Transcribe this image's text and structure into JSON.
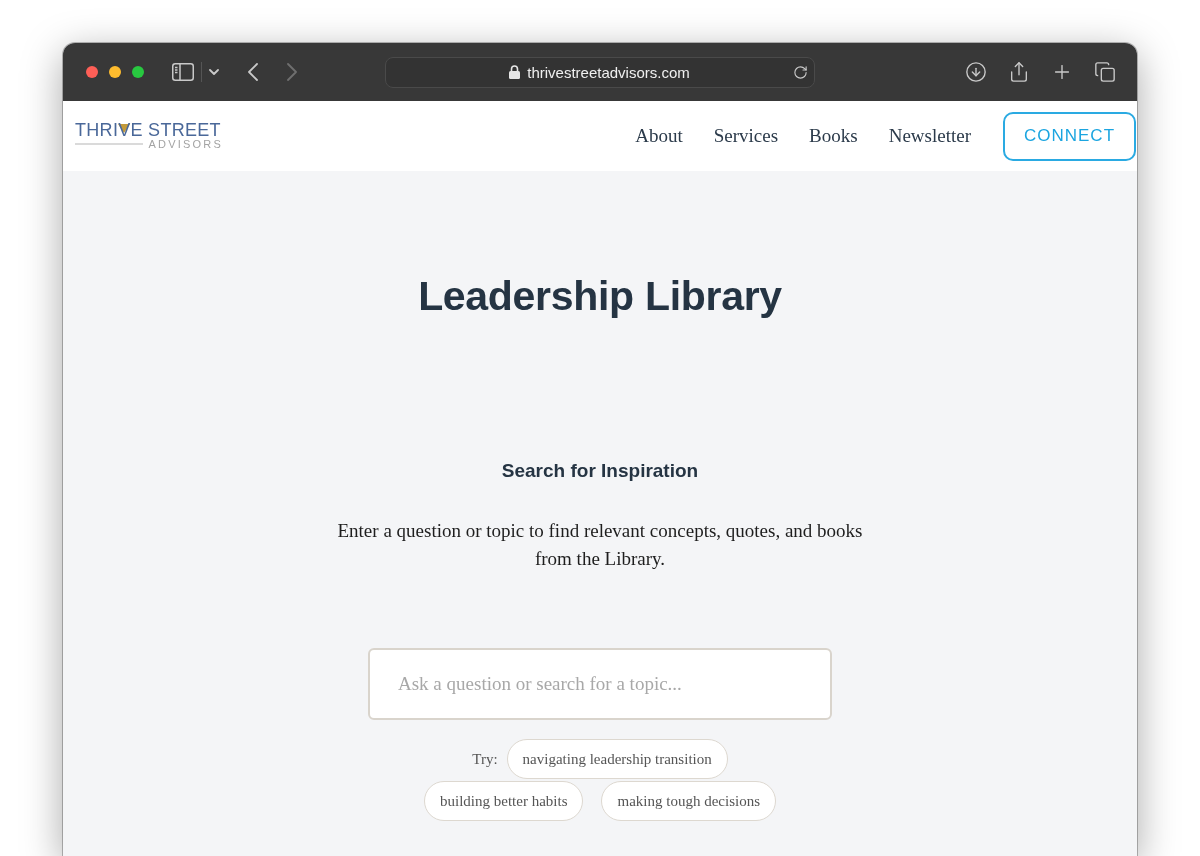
{
  "browser": {
    "url": "thrivestreetadvisors.com",
    "back": {
      "disabled": false
    },
    "forward": {
      "disabled": true
    }
  },
  "site_header": {
    "logo": {
      "name": "THRIVE STREET",
      "tagline": "ADVISORS"
    },
    "nav": [
      "About",
      "Services",
      "Books",
      "Newsletter"
    ],
    "cta": "CONNECT"
  },
  "hero": {
    "title": "Leadership Library"
  },
  "search": {
    "heading": "Search for Inspiration",
    "description": "Enter a question or topic to find relevant concepts, quotes, and books from the Library.",
    "placeholder": "Ask a question or search for a topic...",
    "suggestions_label": "Try:",
    "suggestions": [
      "navigating leadership transition",
      "building better habits",
      "making tough decisions"
    ]
  }
}
